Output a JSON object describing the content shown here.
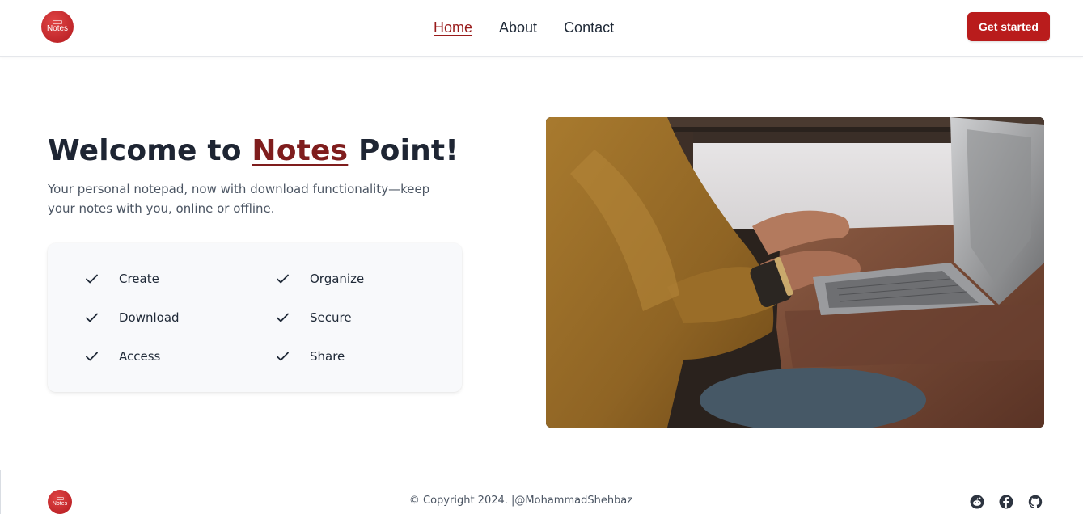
{
  "header": {
    "logo_text": "Notes",
    "nav": [
      {
        "label": "Home",
        "active": true
      },
      {
        "label": "About",
        "active": false
      },
      {
        "label": "Contact",
        "active": false
      }
    ],
    "cta_label": "Get started"
  },
  "hero": {
    "title_prefix": "Welcome to ",
    "title_brand": "Notes",
    "title_suffix": " Point!",
    "subtitle": "Your personal notepad, now with download functionality—keep your notes with you, online or offline.",
    "image_icon": "laptop-typing-photo"
  },
  "features": [
    {
      "label": "Create",
      "icon": "check-icon"
    },
    {
      "label": "Organize",
      "icon": "check-icon"
    },
    {
      "label": "Download",
      "icon": "check-icon"
    },
    {
      "label": "Secure",
      "icon": "check-icon"
    },
    {
      "label": "Access",
      "icon": "check-icon"
    },
    {
      "label": "Share",
      "icon": "check-icon"
    }
  ],
  "footer": {
    "logo_text": "Notes",
    "copyright": "© Copyright 2024. |@MohammadShehbaz",
    "socials": [
      "reddit-icon",
      "facebook-icon",
      "github-icon"
    ]
  },
  "colors": {
    "brand_red": "#b91c1c",
    "brand_dark_red": "#7f1d1d",
    "text_dark": "#1e2533"
  }
}
